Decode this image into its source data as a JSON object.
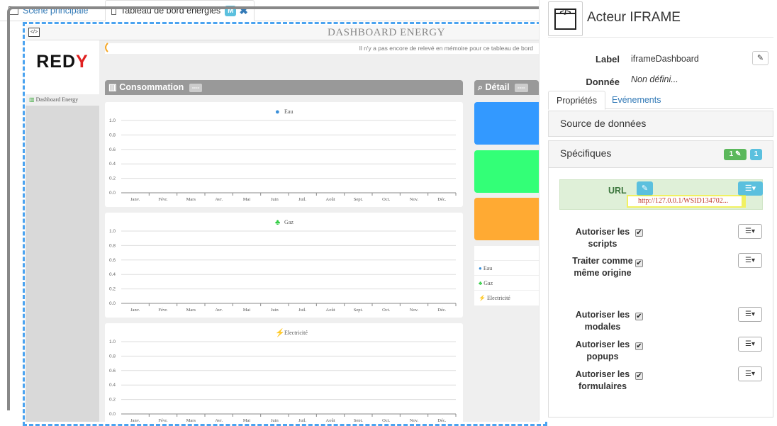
{
  "tabs": [
    {
      "label": "Scène principale"
    },
    {
      "label": "Tableau de bord énergies",
      "badge": "M",
      "close": "✖"
    }
  ],
  "dashboard": {
    "title": "DASHBOARD ENERGY",
    "logo": "REDY",
    "logo_main": "RED",
    "logo_accent": "Y",
    "nav_item": "Dashboard Energy",
    "notice": "Il n'y a pas encore de relevé en mémoire pour ce tableau de bord",
    "consumption_title": "Consommation",
    "detail_title": "Détail",
    "pill": "----",
    "months": [
      "Janv.",
      "Févr.",
      "Mars",
      "Avr.",
      "Mai",
      "Juin",
      "Juil.",
      "Août",
      "Sept.",
      "Oct.",
      "Nov.",
      "Déc."
    ],
    "yticks": [
      "1.0",
      "0.8",
      "0.6",
      "0.4",
      "0.2",
      "0.0"
    ],
    "charts": [
      {
        "title": "Eau",
        "icon": "water-drop-icon",
        "color": "#3a8fd9"
      },
      {
        "title": "Gaz",
        "icon": "flame-icon",
        "color": "#2ecc40"
      },
      {
        "title": "Electricité",
        "icon": "lightning-icon",
        "color": "#f5a623"
      }
    ],
    "tiles": [
      {
        "color": "#3399ff"
      },
      {
        "color": "#33ff77"
      },
      {
        "color": "#ffaa33"
      }
    ],
    "legend": [
      "Eau",
      "Gaz",
      "Electricité"
    ]
  },
  "panel": {
    "actor_title": "Acteur IFRAME",
    "label_field": "Label",
    "label_value": "iframeDashboard",
    "data_field": "Donnée",
    "data_value": "Non défini...",
    "tab_props": "Propriétés",
    "tab_events": "Evénements",
    "source_section": "Source de données",
    "specific_section": "Spécifiques",
    "badge_green": "1",
    "badge_blue": "1",
    "url_label": "URL",
    "url_value": "http://127.0.0.1/WSID134702...",
    "options": [
      {
        "label": "Autoriser les scripts",
        "checked": true
      },
      {
        "label": "Traiter comme même origine",
        "checked": true
      },
      {
        "label": "Autoriser les modales",
        "checked": true
      },
      {
        "label": "Autoriser les popups",
        "checked": true
      },
      {
        "label": "Autoriser les formulaires",
        "checked": true
      }
    ]
  }
}
